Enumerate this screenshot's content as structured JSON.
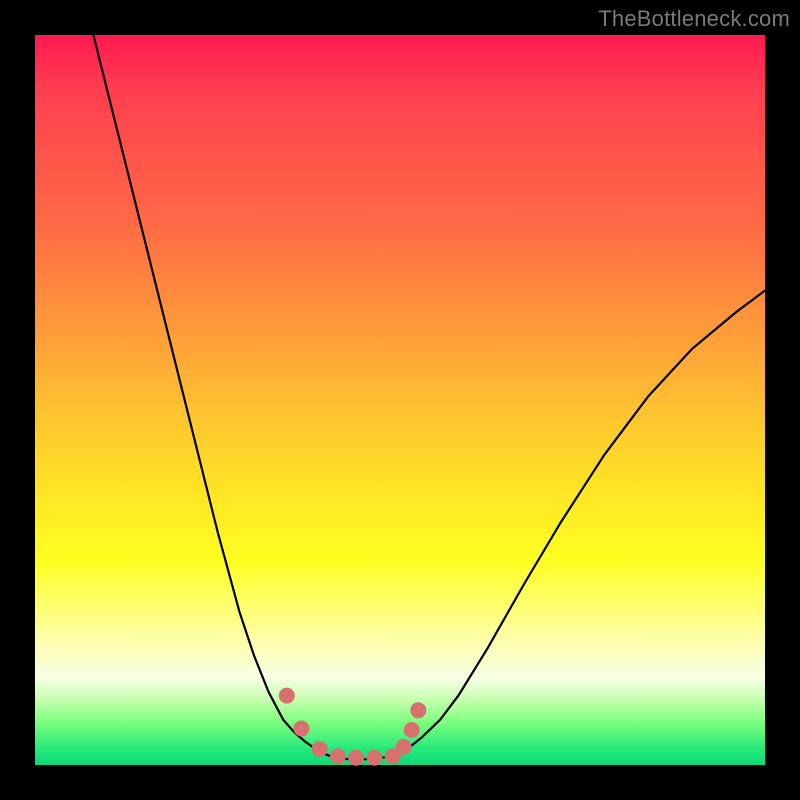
{
  "watermark": "TheBottleneck.com",
  "chart_data": {
    "type": "line",
    "title": "",
    "xlabel": "",
    "ylabel": "",
    "xlim": [
      0,
      1
    ],
    "ylim": [
      0,
      1
    ],
    "series": [
      {
        "name": "curve",
        "x": [
          0.08,
          0.1,
          0.13,
          0.16,
          0.19,
          0.22,
          0.25,
          0.28,
          0.3,
          0.32,
          0.34,
          0.355,
          0.37,
          0.39,
          0.41,
          0.43,
          0.46,
          0.49,
          0.51,
          0.53,
          0.555,
          0.58,
          0.62,
          0.67,
          0.72,
          0.78,
          0.84,
          0.9,
          0.96,
          1.0
        ],
        "y": [
          1.0,
          0.92,
          0.8,
          0.68,
          0.56,
          0.44,
          0.32,
          0.21,
          0.15,
          0.1,
          0.062,
          0.045,
          0.032,
          0.018,
          0.01,
          0.008,
          0.008,
          0.012,
          0.022,
          0.038,
          0.062,
          0.095,
          0.16,
          0.248,
          0.332,
          0.425,
          0.505,
          0.57,
          0.62,
          0.65
        ]
      }
    ],
    "markers": {
      "name": "dots",
      "color": "#d97070",
      "radius": 8,
      "x": [
        0.345,
        0.365,
        0.39,
        0.415,
        0.44,
        0.465,
        0.49,
        0.505,
        0.516,
        0.525
      ],
      "y": [
        0.095,
        0.05,
        0.022,
        0.012,
        0.01,
        0.01,
        0.012,
        0.025,
        0.048,
        0.075
      ]
    }
  }
}
